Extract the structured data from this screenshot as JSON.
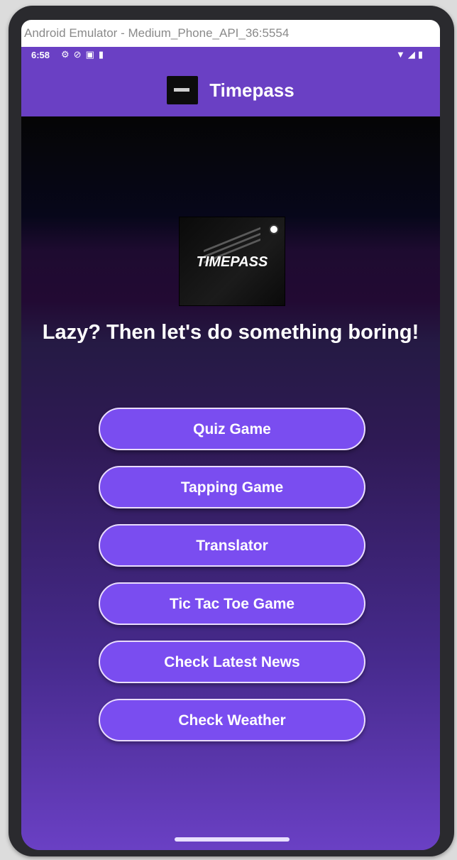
{
  "window": {
    "title": "Android Emulator - Medium_Phone_API_36:5554"
  },
  "status_bar": {
    "time": "6:58",
    "left_icons": [
      "gear-icon",
      "dnd-icon",
      "notification-icon",
      "sdcard-icon"
    ],
    "right_icons": [
      "wifi-icon",
      "signal-icon",
      "battery-icon"
    ]
  },
  "app_bar": {
    "title": "Timepass"
  },
  "hero": {
    "logo_text": "TIMEPASS"
  },
  "tagline": "Lazy? Then let's do something boring!",
  "menu": {
    "buttons": [
      {
        "label": "Quiz Game"
      },
      {
        "label": "Tapping Game"
      },
      {
        "label": "Translator"
      },
      {
        "label": "Tic Tac Toe Game"
      },
      {
        "label": "Check Latest News"
      },
      {
        "label": "Check Weather"
      }
    ]
  },
  "colors": {
    "accent": "#6a40c4",
    "button": "#7a4df0",
    "button_border": "#e9dcff"
  }
}
